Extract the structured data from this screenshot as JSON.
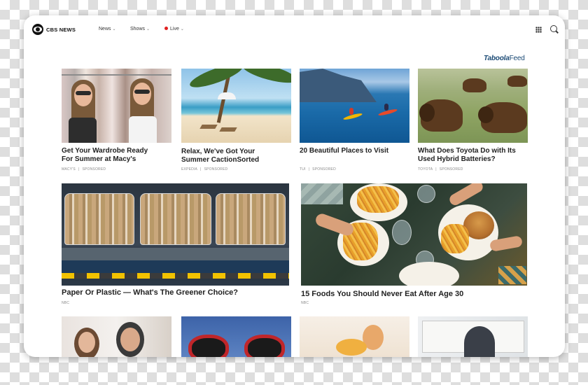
{
  "nav": {
    "brand": "CBS NEWS",
    "items": [
      {
        "label": "News"
      },
      {
        "label": "Shows"
      },
      {
        "label": "Live"
      }
    ],
    "live_dot_color": "#e02020",
    "icons": [
      "grid-icon",
      "search-icon"
    ]
  },
  "feed": {
    "brand_main": "Taboola",
    "brand_suffix": "Feed",
    "brand_color": "#1b4a75"
  },
  "cards_top": [
    {
      "title_line1": "Get Your Wardrobe Ready",
      "title_line2": "For Summer at Macy's",
      "source": "MACY'S",
      "tag": "SPONSORED"
    },
    {
      "title_line1": "Relax, We've Got Your",
      "title_line2": "Summer CactionSorted",
      "source": "EXPEDIA",
      "tag": "SPONSORED"
    },
    {
      "title_line1": "20 Beautiful Places to Visit",
      "title_line2": "",
      "source": "TUI",
      "tag": "SPONSORED"
    },
    {
      "title_line1": "What Does Toyota Do with Its",
      "title_line2": "Used Hybrid Batteries?",
      "source": "TOYOTA",
      "tag": "SPONSORED"
    }
  ],
  "cards_mid": [
    {
      "title": "Paper Or Plastic — What's The Greener Choice?",
      "source": "NBC"
    },
    {
      "title": "15 Foods You Should Never Eat After Age 30",
      "source": "NBC"
    }
  ]
}
